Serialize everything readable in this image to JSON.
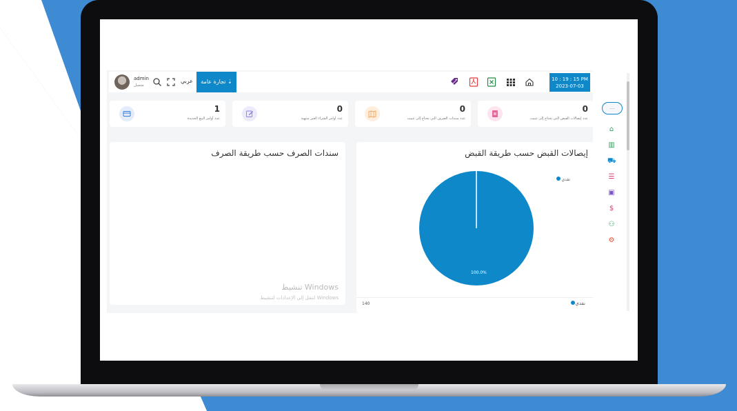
{
  "colors": {
    "accent": "#0e88c9",
    "background_blue": "#3f8bd3",
    "laptop": "#0d0d0f"
  },
  "topbar": {
    "clock_time": "10 : 19 : 15 PM",
    "clock_date": "2023-07-03",
    "company_button": "تجارة عامة ⇣",
    "language": "عربي",
    "user_name": "admin",
    "user_status": "متصل"
  },
  "cards": [
    {
      "value": "0",
      "label": "عدد إيصالات القبض التي تحتاج إلى تثبيت",
      "icon": "receipt-icon",
      "color": "#e5669a"
    },
    {
      "value": "0",
      "label": "عدد سندات الصرف التي تحتاج إلى تثبيت",
      "icon": "map-icon",
      "color": "#f2a65a"
    },
    {
      "value": "0",
      "label": "عدد أوامر الشراء الغير منتهية",
      "icon": "edit-icon",
      "color": "#8b7fe0"
    },
    {
      "value": "1",
      "label": "عدد أوامر البيع الجديدة",
      "icon": "card-icon",
      "color": "#3a7bd5"
    }
  ],
  "panels": {
    "receipts": {
      "title": "إيصالات القبض حسب طريقة القبض",
      "legend_top": "نقدي",
      "pie_label": "100.0%",
      "footer_label": "نقدي",
      "footer_value": "140"
    },
    "payments": {
      "title": "سندات الصرف حسب طريقة الصرف",
      "watermark_title": "تنشيط Windows",
      "watermark_sub": "انتقل إلى الإعدادات لتنشيط Windows"
    }
  },
  "sidebar": {
    "pill_label": "...",
    "icons": [
      {
        "name": "home-icon",
        "glyph": "⌂",
        "color": "#2e9e5b"
      },
      {
        "name": "bank-icon",
        "glyph": "▥",
        "color": "#2e9e5b"
      },
      {
        "name": "cart-icon",
        "glyph": "⛟",
        "color": "#0e88c9"
      },
      {
        "name": "database-icon",
        "glyph": "☰",
        "color": "#d63a6c"
      },
      {
        "name": "box-icon",
        "glyph": "▣",
        "color": "#7a55c9"
      },
      {
        "name": "dollar-icon",
        "glyph": "$",
        "color": "#d63a6c"
      },
      {
        "name": "users-icon",
        "glyph": "⚇",
        "color": "#2e9e5b"
      },
      {
        "name": "settings-icon",
        "glyph": "⚙",
        "color": "#e14b2f"
      }
    ]
  },
  "chart_data": {
    "type": "pie",
    "categories": [
      "نقدي"
    ],
    "values": [
      100
    ],
    "value_labels": [
      "100.0%"
    ],
    "legend_placement": "top-right"
  }
}
